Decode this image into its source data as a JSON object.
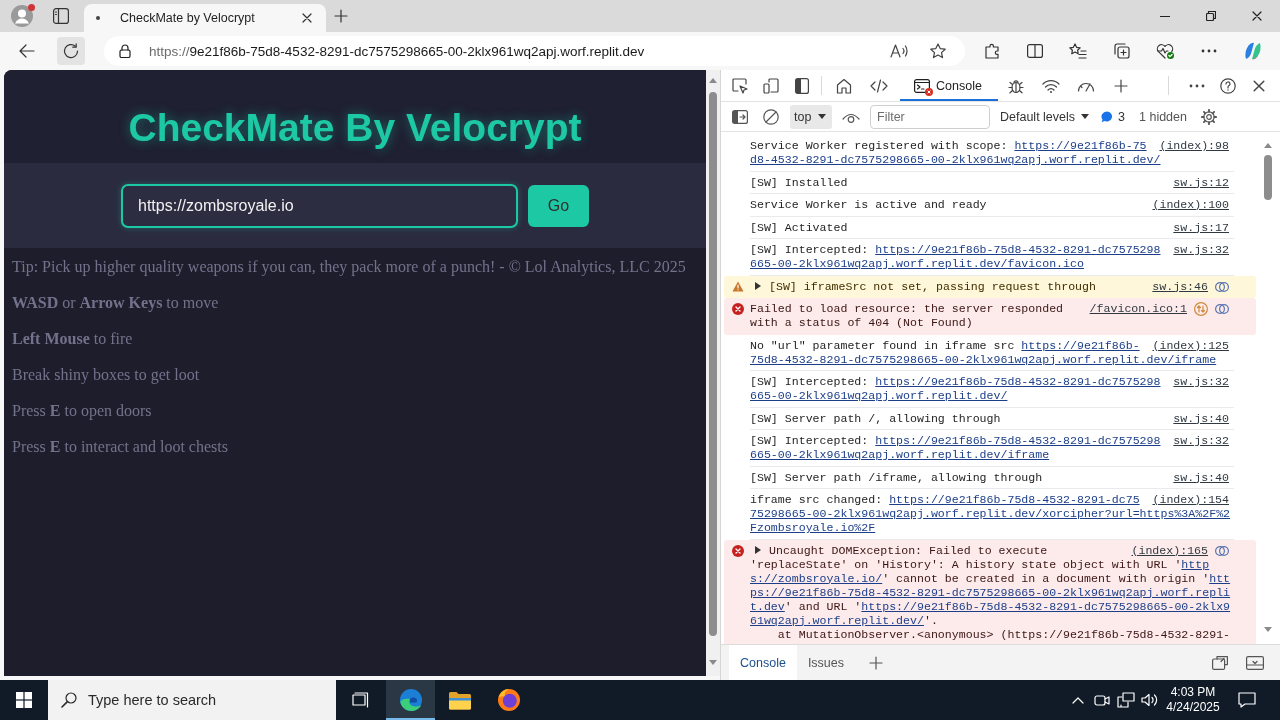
{
  "browser": {
    "profile": {
      "notification": true
    },
    "tabs": [
      {
        "title": "CheckMate by Velocrypt",
        "selected": true
      }
    ],
    "address_bar": {
      "scheme": "https://",
      "host": "9e21f86b-75d8-4532-8291-dc7575298665-00-2klx961wq2apj.worf.replit.dev"
    }
  },
  "page": {
    "title": "CheckMate By Velocrypt",
    "url_input": {
      "value": "https://zombsroyale.io"
    },
    "go_button": "Go",
    "lines": [
      "Tip: Pick up higher quality weapons if you can, they pack more of a punch! - © Lol Analytics, LLC 2025",
      "**WASD** or **Arrow Keys** to move",
      "**Left Mouse** to fire",
      "Break shiny boxes to get loot",
      "Press **E** to open doors",
      "Press **E** to interact and loot chests"
    ]
  },
  "devtools": {
    "panel_tabs": [
      {
        "kind": "home",
        "selected": false,
        "errors": false
      },
      {
        "kind": "code",
        "selected": false,
        "errors": false
      },
      {
        "kind": "console",
        "label": "Console",
        "selected": true,
        "errors": true
      },
      {
        "kind": "bug",
        "selected": false,
        "errors": false
      },
      {
        "kind": "wifi",
        "selected": false,
        "errors": false
      },
      {
        "kind": "gauge",
        "selected": false,
        "errors": false
      }
    ],
    "context": "top",
    "filter": {
      "placeholder": "Filter"
    },
    "levels": "Default levels",
    "issues_count": "3",
    "hidden": "1 hidden",
    "messages": [
      {
        "kind": "log",
        "expandable": false,
        "network": false,
        "parts": [
          {
            "kind": "text",
            "text": "Service Worker registered with scope: "
          },
          {
            "kind": "link",
            "text": "https://9e21f86b-75d8-4532-8291-dc7575298665-00-2klx961wq2apj.worf.replit.dev/"
          }
        ],
        "source": "(index):98"
      },
      {
        "kind": "log",
        "expandable": false,
        "network": false,
        "parts": [
          {
            "kind": "text",
            "text": "[SW] Installed"
          }
        ],
        "source": "sw.js:12"
      },
      {
        "kind": "log",
        "expandable": false,
        "network": false,
        "parts": [
          {
            "kind": "text",
            "text": "Service Worker is active and ready"
          }
        ],
        "source": "(index):100"
      },
      {
        "kind": "log",
        "expandable": false,
        "network": false,
        "parts": [
          {
            "kind": "text",
            "text": "[SW] Activated"
          }
        ],
        "source": "sw.js:17"
      },
      {
        "kind": "log",
        "expandable": false,
        "network": false,
        "parts": [
          {
            "kind": "text",
            "text": "[SW] Intercepted: "
          },
          {
            "kind": "link",
            "text": "https://9e21f86b-75d8-4532-8291-dc7575298665-00-2klx961wq2apj.worf.replit.dev/favicon.ico"
          }
        ],
        "source": "sw.js:32"
      },
      {
        "kind": "warning",
        "expandable": true,
        "network": false,
        "parts": [
          {
            "kind": "text",
            "text": "[SW] iframeSrc not set, passing request through"
          }
        ],
        "source": "sw.js:46"
      },
      {
        "kind": "error",
        "expandable": false,
        "network": true,
        "parts": [
          {
            "kind": "text",
            "text": "Failed to load resource: the server responded with a status of 404 (Not Found)"
          }
        ],
        "source": "/favicon.ico:1"
      },
      {
        "kind": "log",
        "expandable": false,
        "network": false,
        "parts": [
          {
            "kind": "text",
            "text": "No \"url\" parameter found in iframe src "
          },
          {
            "kind": "link",
            "text": "https://9e21f86b-75d8-4532-8291-dc7575298665-00-2klx961wq2apj.worf.replit.dev/iframe"
          }
        ],
        "source": "(index):125"
      },
      {
        "kind": "log",
        "expandable": false,
        "network": false,
        "parts": [
          {
            "kind": "text",
            "text": "[SW] Intercepted: "
          },
          {
            "kind": "link",
            "text": "https://9e21f86b-75d8-4532-8291-dc7575298665-00-2klx961wq2apj.worf.replit.dev/"
          }
        ],
        "source": "sw.js:32"
      },
      {
        "kind": "log",
        "expandable": false,
        "network": false,
        "parts": [
          {
            "kind": "text",
            "text": "[SW] Server path /, allowing through"
          }
        ],
        "source": "sw.js:40"
      },
      {
        "kind": "log",
        "expandable": false,
        "network": false,
        "parts": [
          {
            "kind": "text",
            "text": "[SW] Intercepted: "
          },
          {
            "kind": "link",
            "text": "https://9e21f86b-75d8-4532-8291-dc7575298665-00-2klx961wq2apj.worf.replit.dev/iframe"
          }
        ],
        "source": "sw.js:32"
      },
      {
        "kind": "log",
        "expandable": false,
        "network": false,
        "parts": [
          {
            "kind": "text",
            "text": "[SW] Server path /iframe, allowing through"
          }
        ],
        "source": "sw.js:40"
      },
      {
        "kind": "log",
        "expandable": false,
        "network": false,
        "parts": [
          {
            "kind": "text",
            "text": "iframe src changed: "
          },
          {
            "kind": "link",
            "text": "https://9e21f86b-75d8-4532-8291-dc7575298665-00-2klx961wq2apj.worf.replit.dev/xorcipher?url=https%3A%2F%2Fzombsroyale.io%2F"
          }
        ],
        "source": "(index):154"
      },
      {
        "kind": "error",
        "expandable": true,
        "network": false,
        "parts": [
          {
            "kind": "text",
            "text": "Uncaught DOMException: Failed to execute 'replaceState' on 'History': A history state object with URL '"
          },
          {
            "kind": "link",
            "text": "https://zombsroyale.io/"
          },
          {
            "kind": "text",
            "text": "' cannot be created in a document with origin '"
          },
          {
            "kind": "link",
            "text": "https://9e21f86b-75d8-4532-8291-dc7575298665-00-2klx961wq2apj.worf.replit.dev"
          },
          {
            "kind": "text",
            "text": "' and URL '"
          },
          {
            "kind": "link",
            "text": "https://9e21f86b-75d8-4532-8291-dc7575298665-00-2klx961wq2apj.worf.replit.dev/"
          },
          {
            "kind": "text",
            "text": "'."
          },
          {
            "kind": "stack",
            "text": "at MutationObserver.<anonymous> (https://9e21f86b-75d8-4532-8291-"
          }
        ],
        "source": "(index):165"
      }
    ],
    "drawer_tabs": [
      {
        "label": "Console",
        "selected": true
      },
      {
        "label": "Issues",
        "selected": false
      }
    ]
  },
  "taskbar": {
    "search": {
      "placeholder": "Type here to search"
    },
    "apps": [
      {
        "kind": "edge",
        "selected": true
      },
      {
        "kind": "folder",
        "selected": false
      },
      {
        "kind": "firefox",
        "selected": false
      }
    ],
    "time": "4:03 PM",
    "date": "4/24/2025"
  }
}
